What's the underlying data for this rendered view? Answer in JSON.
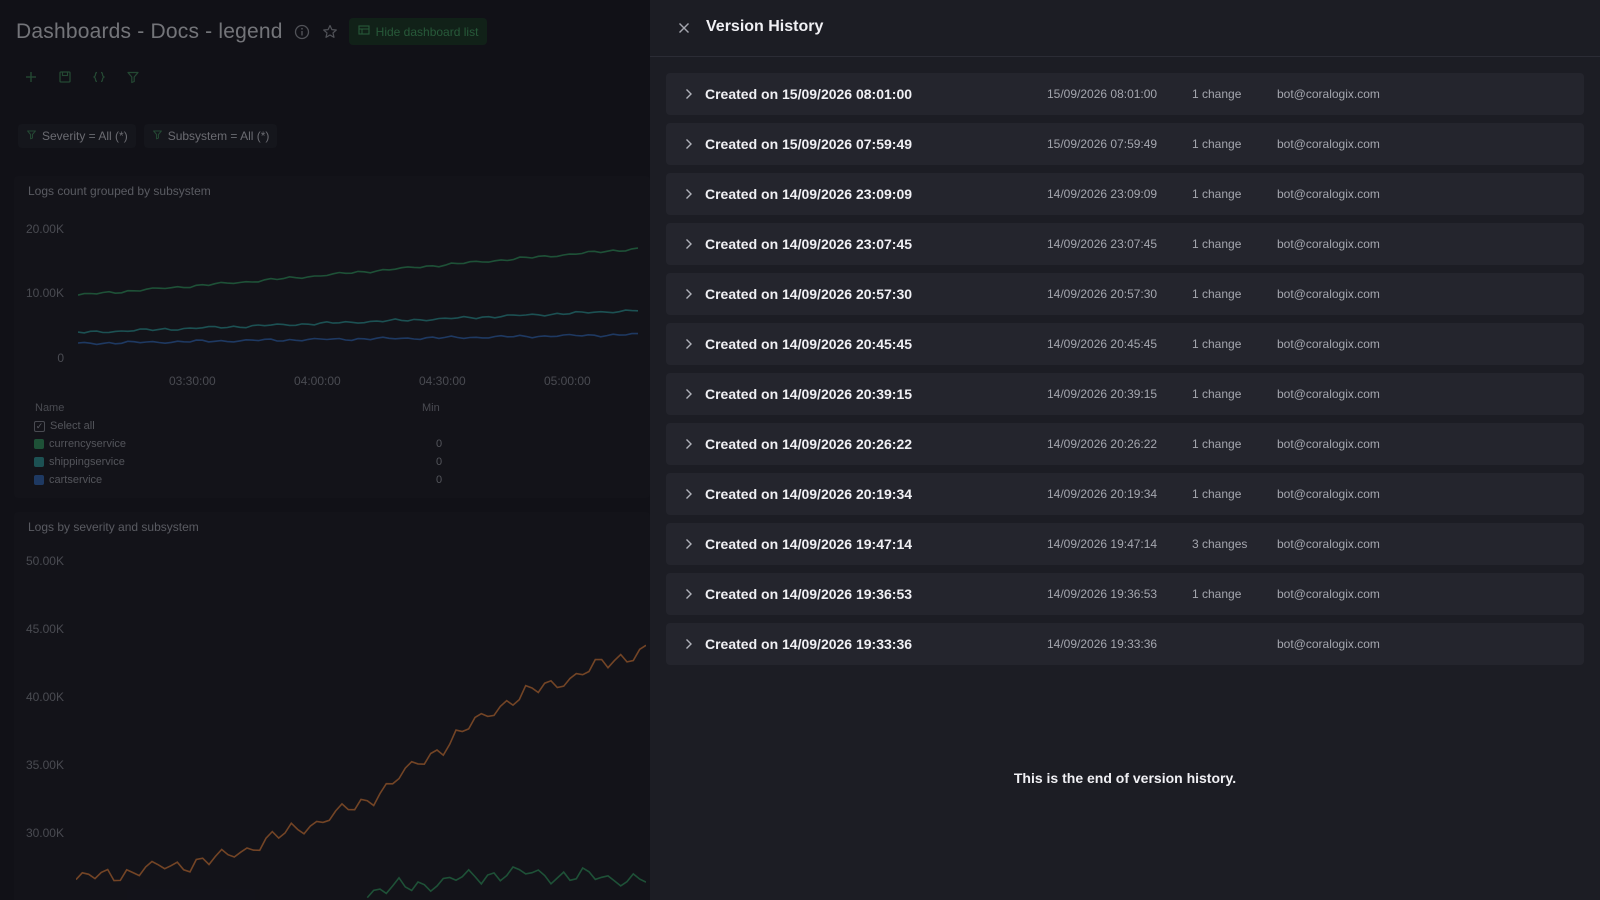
{
  "dashboard": {
    "title": "Dashboards - Docs - legend",
    "hide_button_label": "Hide dashboard list",
    "filters": [
      {
        "label": "Severity = All (*)"
      },
      {
        "label": "Subsystem = All (*)"
      }
    ],
    "widget1": {
      "title": "Logs count grouped by subsystem",
      "legend_name_header": "Name",
      "legend_min_header": "Min",
      "select_all_label": "Select all",
      "legend": [
        {
          "name": "currencyservice",
          "min": "0",
          "color": "#2e8b5a"
        },
        {
          "name": "shippingservice",
          "min": "0",
          "color": "#2a8a8c"
        },
        {
          "name": "cartservice",
          "min": "0",
          "color": "#2f5fa8"
        }
      ]
    },
    "widget2": {
      "title": "Logs by severity and subsystem"
    }
  },
  "chart_data": [
    {
      "type": "line",
      "title": "Logs count grouped by subsystem",
      "x_ticks": [
        "03:30:00",
        "04:00:00",
        "04:30:00",
        "05:00:00"
      ],
      "y_ticks": [
        "20.00K",
        "10.00K",
        "0"
      ],
      "ylim": [
        0,
        22000
      ],
      "x": [
        0,
        0.33,
        0.66,
        1.0
      ],
      "series": [
        {
          "name": "currencyservice",
          "color": "#2e8b5a",
          "values": [
            10200,
            12500,
            15000,
            17500
          ]
        },
        {
          "name": "shippingservice",
          "color": "#2a8a8c",
          "values": [
            4300,
            5400,
            6500,
            7800
          ]
        },
        {
          "name": "cartservice",
          "color": "#2f5fa8",
          "values": [
            2600,
            3100,
            3500,
            4000
          ]
        }
      ]
    },
    {
      "type": "line",
      "title": "Logs by severity and subsystem",
      "y_ticks": [
        "50.00K",
        "45.00K",
        "40.00K",
        "35.00K",
        "30.00K"
      ],
      "ylim": [
        26500,
        51500
      ],
      "x": [
        0,
        0.25,
        0.5,
        0.75,
        1.0
      ],
      "series": [
        {
          "color": "#c8733a",
          "values": [
            28000,
            29500,
            33500,
            41000,
            45000
          ]
        },
        {
          "color": "#2e8b5a",
          "values": [
            null,
            null,
            27000,
            28500,
            28000
          ]
        }
      ]
    }
  ],
  "drawer": {
    "title": "Version History",
    "end_message": "This is the end of version history.",
    "versions": [
      {
        "title": "Created on 15/09/2026 08:01:00",
        "date": "15/09/2026 08:01:00",
        "changes": "1 change",
        "user": "bot@coralogix.com"
      },
      {
        "title": "Created on 15/09/2026 07:59:49",
        "date": "15/09/2026 07:59:49",
        "changes": "1 change",
        "user": "bot@coralogix.com"
      },
      {
        "title": "Created on 14/09/2026 23:09:09",
        "date": "14/09/2026 23:09:09",
        "changes": "1 change",
        "user": "bot@coralogix.com"
      },
      {
        "title": "Created on 14/09/2026 23:07:45",
        "date": "14/09/2026 23:07:45",
        "changes": "1 change",
        "user": "bot@coralogix.com"
      },
      {
        "title": "Created on 14/09/2026 20:57:30",
        "date": "14/09/2026 20:57:30",
        "changes": "1 change",
        "user": "bot@coralogix.com"
      },
      {
        "title": "Created on 14/09/2026 20:45:45",
        "date": "14/09/2026 20:45:45",
        "changes": "1 change",
        "user": "bot@coralogix.com"
      },
      {
        "title": "Created on 14/09/2026 20:39:15",
        "date": "14/09/2026 20:39:15",
        "changes": "1 change",
        "user": "bot@coralogix.com"
      },
      {
        "title": "Created on 14/09/2026 20:26:22",
        "date": "14/09/2026 20:26:22",
        "changes": "1 change",
        "user": "bot@coralogix.com"
      },
      {
        "title": "Created on 14/09/2026 20:19:34",
        "date": "14/09/2026 20:19:34",
        "changes": "1 change",
        "user": "bot@coralogix.com"
      },
      {
        "title": "Created on 14/09/2026 19:47:14",
        "date": "14/09/2026 19:47:14",
        "changes": "3 changes",
        "user": "bot@coralogix.com"
      },
      {
        "title": "Created on 14/09/2026 19:36:53",
        "date": "14/09/2026 19:36:53",
        "changes": "1 change",
        "user": "bot@coralogix.com"
      },
      {
        "title": "Created on 14/09/2026 19:33:36",
        "date": "14/09/2026 19:33:36",
        "changes": "",
        "user": "bot@coralogix.com"
      }
    ]
  }
}
